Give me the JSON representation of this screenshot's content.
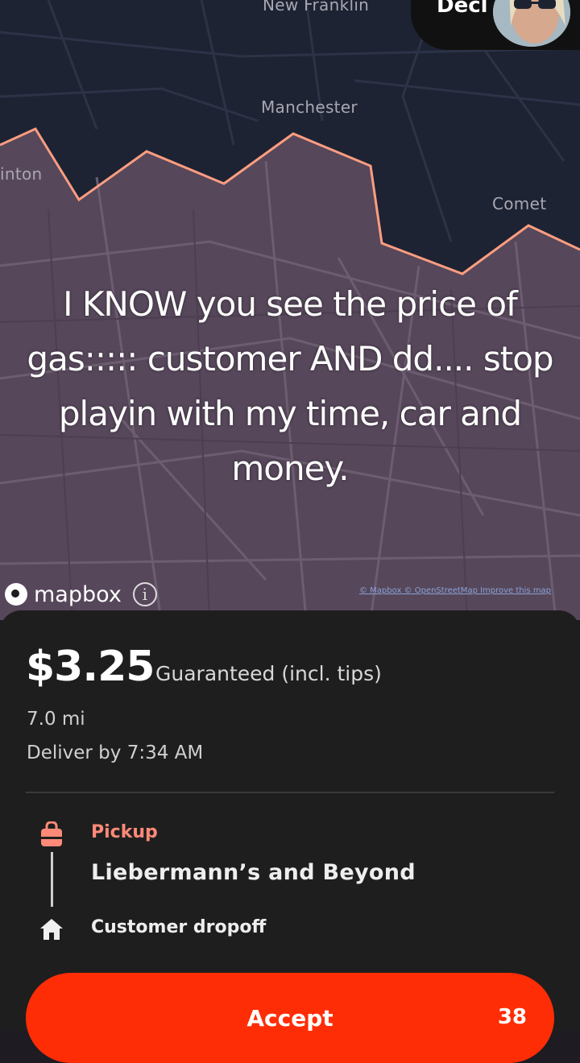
{
  "map": {
    "labels": {
      "new_franklin": "New Franklin",
      "manchester": "Manchester",
      "clinton": "inton",
      "comet": "Comet"
    },
    "mapbox_logo_text": "mapbox",
    "info_icon": "info-icon",
    "attribution": "© Mapbox © OpenStreetMap Improve this map",
    "zone_line_color": "#ff9d80",
    "zone_fill_color": "#5a4858"
  },
  "header": {
    "decline_label": "Decl"
  },
  "caption": {
    "text": "I KNOW you see the price of gas::::: customer AND dd.... stop playin with my time, car and money."
  },
  "offer": {
    "price": "$3.25",
    "price_note": "Guaranteed (incl. tips)",
    "distance": "7.0 mi",
    "deliver_by": "Deliver by 7:34 AM",
    "pickup_label": "Pickup",
    "store_name": "Liebermann’s and Beyond",
    "dropoff_label": "Customer dropoff",
    "pickup_icon": "shopping-bag-icon",
    "dropoff_icon": "home-icon",
    "accent_color": "#ff2d06"
  },
  "accept_button": {
    "label": "Accept",
    "countdown": "38"
  }
}
